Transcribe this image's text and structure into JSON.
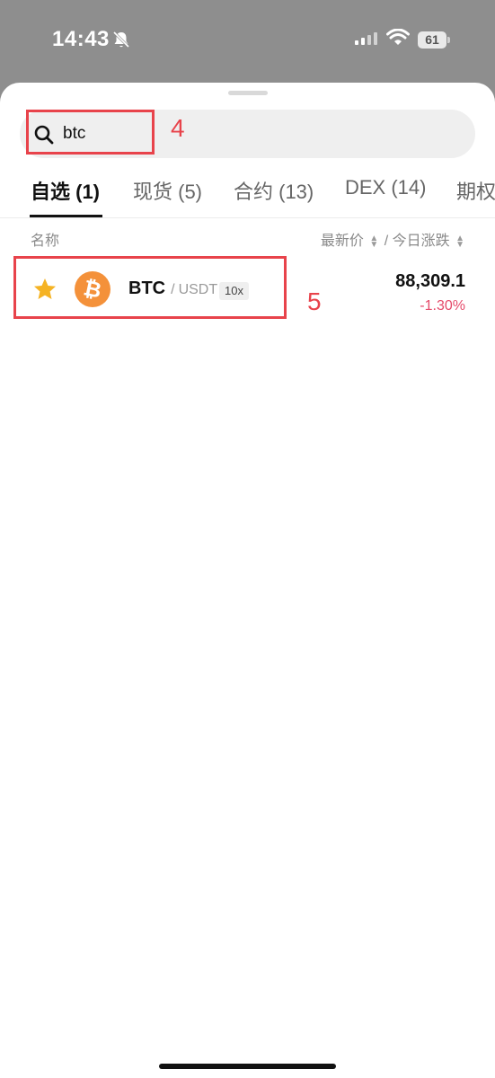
{
  "status_bar": {
    "time": "14:43",
    "battery": "61"
  },
  "search": {
    "value": "btc",
    "placeholder": ""
  },
  "tabs": [
    {
      "label": "自选 (1)",
      "active": true
    },
    {
      "label": "现货 (5)",
      "active": false
    },
    {
      "label": "合约 (13)",
      "active": false
    },
    {
      "label": "DEX (14)",
      "active": false
    },
    {
      "label": "期权",
      "active": false
    }
  ],
  "list_header": {
    "name": "名称",
    "price": "最新价",
    "change": "今日涨跌",
    "separator": "/"
  },
  "rows": [
    {
      "base": "BTC",
      "quote": "USDT",
      "separator": "/",
      "leverage": "10x",
      "price": "88,309.1",
      "change": "-1.30%",
      "favorited": true,
      "icon": "bitcoin-icon"
    }
  ],
  "annotations": {
    "search_box": "4",
    "list_row": "5"
  },
  "colors": {
    "annotation": "#e8434b",
    "negative": "#e54a6a",
    "star": "#f5b324",
    "bitcoin": "#f4913a"
  }
}
